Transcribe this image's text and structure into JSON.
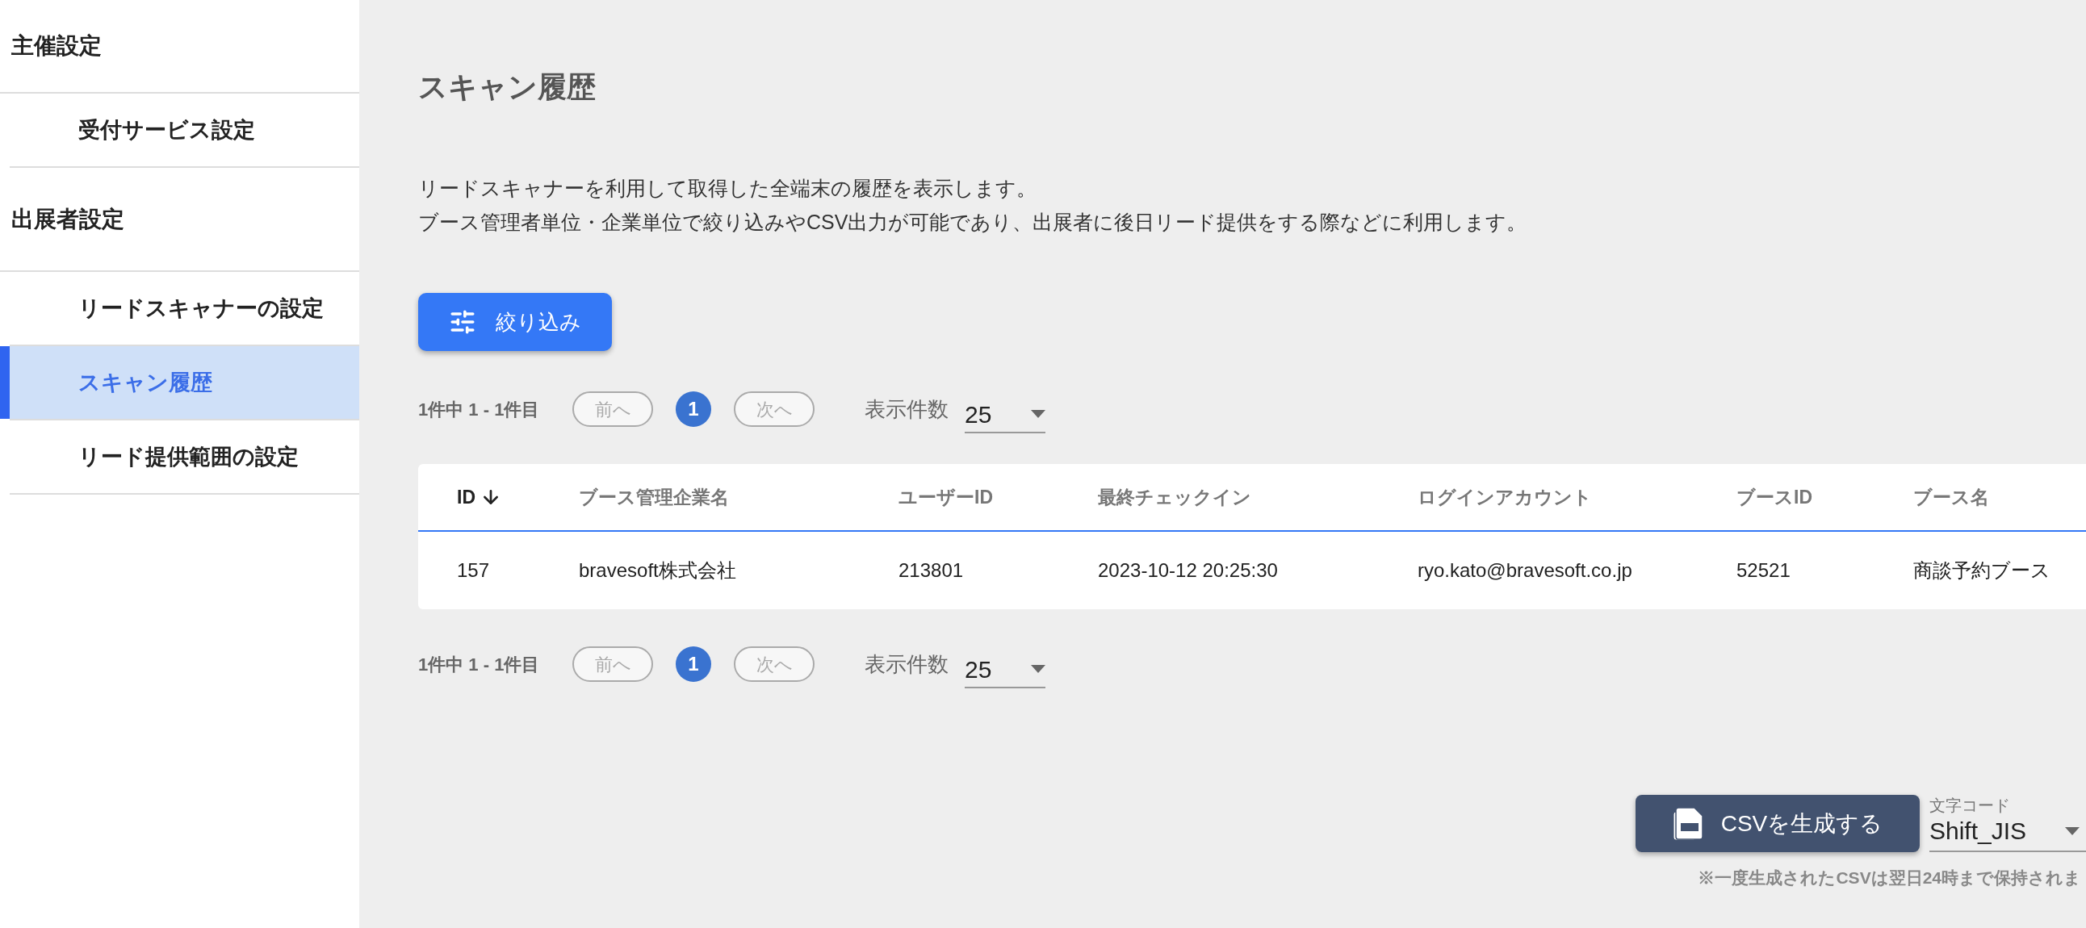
{
  "sidebar": {
    "sections": [
      {
        "label": "主催設定",
        "items": [
          {
            "label": "受付サービス設定",
            "selected": false
          }
        ]
      },
      {
        "label": "出展者設定",
        "items": [
          {
            "label": "リードスキャナーの設定",
            "selected": false
          },
          {
            "label": "スキャン履歴",
            "selected": true
          },
          {
            "label": "リード提供範囲の設定",
            "selected": false
          }
        ]
      }
    ]
  },
  "page": {
    "title": "スキャン履歴",
    "description": [
      "リードスキャナーを利用して取得した全端末の履歴を表示します。",
      "ブース管理者単位・企業単位で絞り込みやCSV出力が可能であり、出展者に後日リード提供をする際などに利用します。"
    ]
  },
  "filter_button": "絞り込み",
  "paginations": [
    {
      "range": "1件中 1 - 1件目",
      "prev": {
        "label": "前へ",
        "disabled": true
      },
      "pages": [
        {
          "label": "1",
          "selected": true
        }
      ],
      "next": {
        "label": "次へ",
        "disabled": true
      },
      "per_page_label": "表示件数",
      "per_page_value": "25"
    },
    {
      "range": "1件中 1 - 1件目",
      "prev": {
        "label": "前へ",
        "disabled": true
      },
      "pages": [
        {
          "label": "1",
          "selected": true
        }
      ],
      "next": {
        "label": "次へ",
        "disabled": true
      },
      "per_page_label": "表示件数",
      "per_page_value": "25"
    }
  ],
  "table": {
    "columns": [
      {
        "label": "ID",
        "sorted_descending": true
      },
      {
        "label": "ブース管理企業名"
      },
      {
        "label": "ユーザーID"
      },
      {
        "label": "最終チェックイン"
      },
      {
        "label": "ログインアカウント"
      },
      {
        "label": "ブースID"
      },
      {
        "label": "ブース名"
      }
    ],
    "rows": [
      [
        "157",
        "bravesoft株式会社",
        "213801",
        "2023-10-12 20:25:30",
        "ryo.kato@bravesoft.co.jp",
        "52521",
        "商談予約ブース"
      ]
    ]
  },
  "csv": {
    "button": "CSVを生成する",
    "encoding_label": "文字コード",
    "encoding_value": "Shift_JIS",
    "note": "※一度生成されたCSVは翌日24時まで保持されま"
  }
}
